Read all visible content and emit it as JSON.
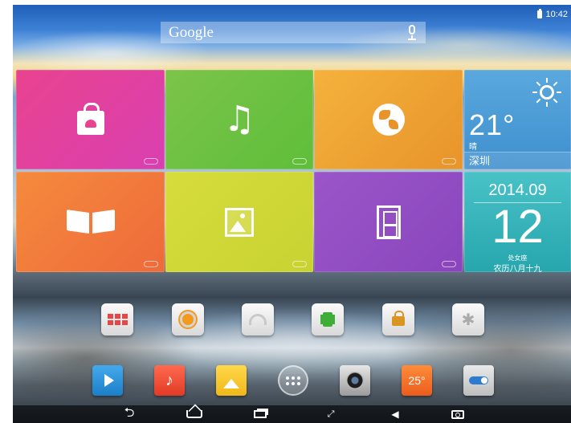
{
  "status_bar": {
    "time": "10:42"
  },
  "search": {
    "logo": "Google"
  },
  "tiles": [
    {
      "id": "store",
      "icon": "shopping-bag-icon",
      "color": "#e9438f"
    },
    {
      "id": "music",
      "icon": "music-note-icon",
      "color": "#7bc44a"
    },
    {
      "id": "browser",
      "icon": "globe-icon",
      "color": "#f4b23c"
    },
    {
      "id": "ebook",
      "icon": "open-book-icon",
      "color": "#f58a3d"
    },
    {
      "id": "gallery",
      "icon": "picture-icon",
      "color": "#d6dc3c"
    },
    {
      "id": "video",
      "icon": "film-icon",
      "color": "#9a56c8"
    }
  ],
  "weather": {
    "temperature": "21°",
    "condition": "晴",
    "city": "深圳",
    "icon": "sun-icon",
    "color": "#4f9fd9"
  },
  "calendar": {
    "year_month": "2014.09",
    "day": "12",
    "zodiac": "处女座",
    "lunar_date": "农历八月十九",
    "color": "#34b3b9"
  },
  "quick_toggles": [
    {
      "name": "task-manager-icon"
    },
    {
      "name": "brightness-icon"
    },
    {
      "name": "wifi-icon"
    },
    {
      "name": "vibrate-icon"
    },
    {
      "name": "screen-lock-icon"
    },
    {
      "name": "bluetooth-icon"
    }
  ],
  "dock": {
    "temperature_label": "25°",
    "items": [
      {
        "name": "video-player-icon"
      },
      {
        "name": "music-app-icon"
      },
      {
        "name": "gallery-app-icon"
      },
      {
        "name": "app-drawer-icon"
      },
      {
        "name": "camera-icon"
      },
      {
        "name": "weather-app-icon"
      },
      {
        "name": "settings-toggle-icon"
      }
    ]
  },
  "nav_bar": {
    "back_glyph": "⮌",
    "expand_glyph": "⤢",
    "volume_glyph": "◀"
  }
}
